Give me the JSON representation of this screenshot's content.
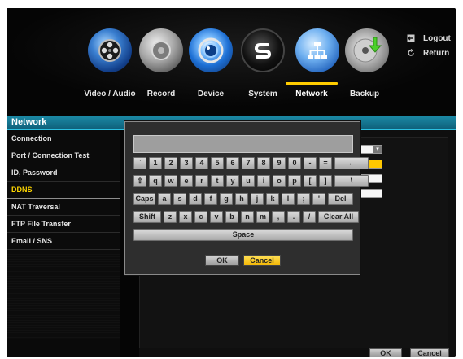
{
  "top_nav": {
    "items": [
      {
        "label": "Video / Audio",
        "icon": "video-audio-icon"
      },
      {
        "label": "Record",
        "icon": "record-icon"
      },
      {
        "label": "Device",
        "icon": "device-icon"
      },
      {
        "label": "System",
        "icon": "system-icon"
      },
      {
        "label": "Network",
        "icon": "network-icon"
      },
      {
        "label": "Backup",
        "icon": "backup-icon"
      }
    ],
    "active": "Network"
  },
  "top_right": {
    "logout_label": "Logout",
    "return_label": "Return"
  },
  "panel": {
    "title": "Network"
  },
  "sidebar": {
    "items": [
      {
        "label": "Connection"
      },
      {
        "label": "Port / Connection Test"
      },
      {
        "label": "ID, Password"
      },
      {
        "label": "DDNS"
      },
      {
        "label": "NAT Traversal"
      },
      {
        "label": "FTP File Transfer"
      },
      {
        "label": "Email / SNS"
      }
    ],
    "selected": "DDNS"
  },
  "keyboard": {
    "input_value": "",
    "rows": [
      [
        "`",
        "1",
        "2",
        "3",
        "4",
        "5",
        "6",
        "7",
        "8",
        "9",
        "0",
        "-",
        "=",
        "←"
      ],
      [
        "⇧",
        "q",
        "w",
        "e",
        "r",
        "t",
        "y",
        "u",
        "i",
        "o",
        "p",
        "[",
        "]",
        "\\"
      ],
      [
        "Caps",
        "a",
        "s",
        "d",
        "f",
        "g",
        "h",
        "j",
        "k",
        "l",
        ";",
        "'",
        "Del"
      ],
      [
        "Shift",
        "z",
        "x",
        "c",
        "v",
        "b",
        "n",
        "m",
        ",",
        ".",
        "/",
        "Clear All"
      ]
    ],
    "space_label": "Space",
    "ok_label": "OK",
    "cancel_label": "Cancel"
  },
  "bottom_buttons": {
    "ok_label": "OK",
    "cancel_label": "Cancel"
  },
  "colors": {
    "accent": "#ffcc00",
    "header": "#1c8ca8",
    "selected_text": "#ffd700"
  }
}
